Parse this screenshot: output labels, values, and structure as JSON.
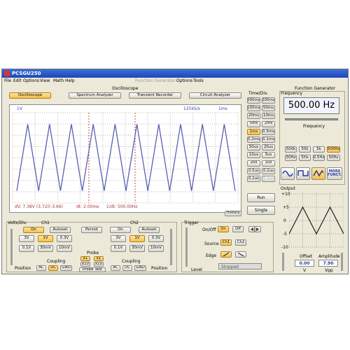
{
  "window": {
    "title": "PCSGU250"
  },
  "menu": {
    "file": "File",
    "edit": "Edit",
    "options": "Options",
    "view": "View",
    "math": "Math",
    "help": "Help",
    "fg_title": "Function Generator",
    "fg_options": "Options",
    "fg_tools": "Tools"
  },
  "oscilloscope": {
    "header": "Oscilloscope",
    "tabs": {
      "oscilloscope": "Oscilloscope",
      "spectrum": "Spectrum Analyzer",
      "recorder": "Transient Recorder",
      "circuit": "Circuit Analyzer"
    },
    "scope_ch": "1V",
    "scope_rate": "125kS/s",
    "scope_time": "1ms",
    "readout": {
      "dv": "dV: 7.38V  (3.72)(-3.66)",
      "dt": "dt: 2.00ms",
      "freq": "1/dt: 500.00Hz"
    },
    "history": "History",
    "run": "Run",
    "single": "Single",
    "timediv_title": "Time/Div.",
    "timediv": [
      "500ms",
      "200ms",
      "100ms",
      "50ms",
      "20ms",
      "10ms",
      "5ms",
      "2ms",
      "1ms",
      "0.5ms",
      "0.2ms",
      "0.1ms",
      "50us",
      "20us",
      "10us",
      "5us",
      "2us",
      "1us",
      "0.5us",
      "0.2us",
      "0.1us",
      "0.1us"
    ]
  },
  "voltsdiv": {
    "title": "Volts/Div.",
    "ch1": {
      "name": "Ch1",
      "on": "On",
      "autoset": "Autoset",
      "r1": [
        "3V",
        "1V",
        "0.3V"
      ],
      "r2": [
        "0.1V",
        "30mV",
        "10mV"
      ]
    },
    "ch2": {
      "name": "Ch2",
      "on": "On",
      "autoset": "Autoset",
      "r1": [
        "3V",
        "1V",
        "0.3V"
      ],
      "r2": [
        "0.1V",
        "30mV",
        "10mV"
      ]
    },
    "persist": "Persist",
    "probe": {
      "title": "Probe",
      "x1": "x1",
      "x1b": "x1",
      "x10": "x10",
      "x10b": "x10",
      "test": "Probe Test"
    },
    "coupling": {
      "title1": "Coupling",
      "title2": "Coupling",
      "ac": "AC",
      "dc": "DC",
      "gnd": "GND"
    },
    "position": "Position"
  },
  "trigger": {
    "title": "Trigger",
    "onoff": "On/Off",
    "on": "On",
    "off": "Off",
    "source": "Source",
    "ch1": "Ch1",
    "ch2": "Ch2",
    "edge": "Edge",
    "level": "Level",
    "status": "Stopped"
  },
  "fg": {
    "title": "Function Generator",
    "freq_title": "Frequency",
    "freq_value": "500.00 Hz",
    "freq_label": "Frequency",
    "ranges": [
      "500k",
      "50k",
      "5k",
      "500Hz",
      "50Hz",
      "5Hz",
      "0.5Hz",
      "50Hz"
    ],
    "more": "MORE FUNCT.",
    "output_title": "Output",
    "yticks": [
      "+10",
      "+5",
      "0",
      "-5",
      "-10"
    ],
    "offset_label": "Offset",
    "offset_value": "0.00",
    "offset_unit": "V",
    "amp_label": "Amplitude",
    "amp_value": "7.90",
    "amp_unit": "Vpp"
  },
  "chart_data": {
    "type": "line",
    "title": "",
    "xlabel": "",
    "ylabel": "",
    "series": [
      {
        "values": [
          -3.66,
          3.72,
          -3.66,
          3.72,
          -3.66,
          3.72,
          -3.66,
          3.72,
          -3.66,
          3.72,
          -3.66,
          3.72,
          -3.66,
          3.72,
          -3.66,
          3.72,
          -3.66,
          3.72,
          -3.66,
          3.72,
          -3.66
        ]
      }
    ],
    "x_period_ms": 2.0,
    "ylim": [
      -5,
      5
    ],
    "grid": true
  },
  "fg_chart": {
    "type": "line",
    "values": [
      -5,
      5,
      -5,
      5,
      -5
    ],
    "ylim": [
      -10,
      10
    ]
  }
}
